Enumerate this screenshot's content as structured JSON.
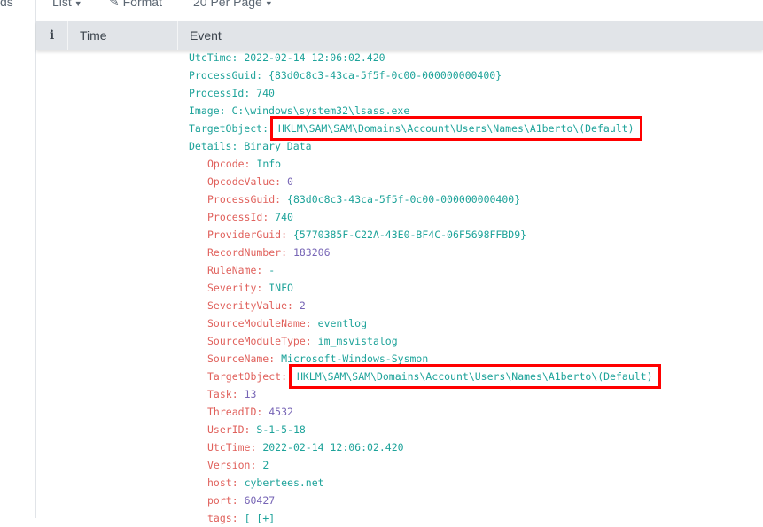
{
  "sidebar": {
    "label_fragment": "ds"
  },
  "toolbar": {
    "list_label": "List",
    "format_label": "Format",
    "per_page_label": "20 Per Page"
  },
  "table": {
    "columns": {
      "info": "i",
      "time": "Time",
      "event": "Event"
    }
  },
  "event": {
    "top_fields": [
      {
        "key": "UtcTime",
        "value": "2022-02-14 12:06:02.420"
      },
      {
        "key": "ProcessGuid",
        "value": "{83d0c8c3-43ca-5f5f-0c00-000000000400}"
      },
      {
        "key": "ProcessId",
        "value": "740"
      },
      {
        "key": "Image",
        "value": "C:\\windows\\system32\\lsass.exe"
      },
      {
        "key": "TargetObject",
        "value": "HKLM\\SAM\\SAM\\Domains\\Account\\Users\\Names\\A1berto\\(Default)",
        "highlighted": true
      },
      {
        "key": "Details",
        "value": "Binary Data"
      }
    ],
    "nested_fields": [
      {
        "key": "Opcode",
        "value": "Info",
        "type": "str"
      },
      {
        "key": "OpcodeValue",
        "value": "0",
        "type": "num"
      },
      {
        "key": "ProcessGuid",
        "value": "{83d0c8c3-43ca-5f5f-0c00-000000000400}",
        "type": "str"
      },
      {
        "key": "ProcessId",
        "value": "740",
        "type": "str"
      },
      {
        "key": "ProviderGuid",
        "value": "{5770385F-C22A-43E0-BF4C-06F5698FFBD9}",
        "type": "str"
      },
      {
        "key": "RecordNumber",
        "value": "183206",
        "type": "num"
      },
      {
        "key": "RuleName",
        "value": "-",
        "type": "str"
      },
      {
        "key": "Severity",
        "value": "INFO",
        "type": "str"
      },
      {
        "key": "SeverityValue",
        "value": "2",
        "type": "num"
      },
      {
        "key": "SourceModuleName",
        "value": "eventlog",
        "type": "str"
      },
      {
        "key": "SourceModuleType",
        "value": "im_msvistalog",
        "type": "str"
      },
      {
        "key": "SourceName",
        "value": "Microsoft-Windows-Sysmon",
        "type": "str"
      },
      {
        "key": "TargetObject",
        "value": "HKLM\\SAM\\SAM\\Domains\\Account\\Users\\Names\\A1berto\\(Default)",
        "type": "str",
        "highlighted": true
      },
      {
        "key": "Task",
        "value": "13",
        "type": "num"
      },
      {
        "key": "ThreadID",
        "value": "4532",
        "type": "num"
      },
      {
        "key": "UserID",
        "value": "S-1-5-18",
        "type": "str"
      },
      {
        "key": "UtcTime",
        "value": "2022-02-14 12:06:02.420",
        "type": "str"
      },
      {
        "key": "Version",
        "value": "2",
        "type": "str"
      },
      {
        "key": "host",
        "value": "cybertees.net",
        "type": "str"
      },
      {
        "key": "port",
        "value": "60427",
        "type": "num"
      },
      {
        "key": "tags",
        "value": "[ [+]",
        "type": "str"
      }
    ]
  },
  "colors": {
    "key_top": "#1ea39a",
    "key_nested": "#e0615c",
    "string": "#1ea39a",
    "number": "#7664b5",
    "highlight_box": "#ff0000",
    "header_bg": "#e1e4e8"
  }
}
